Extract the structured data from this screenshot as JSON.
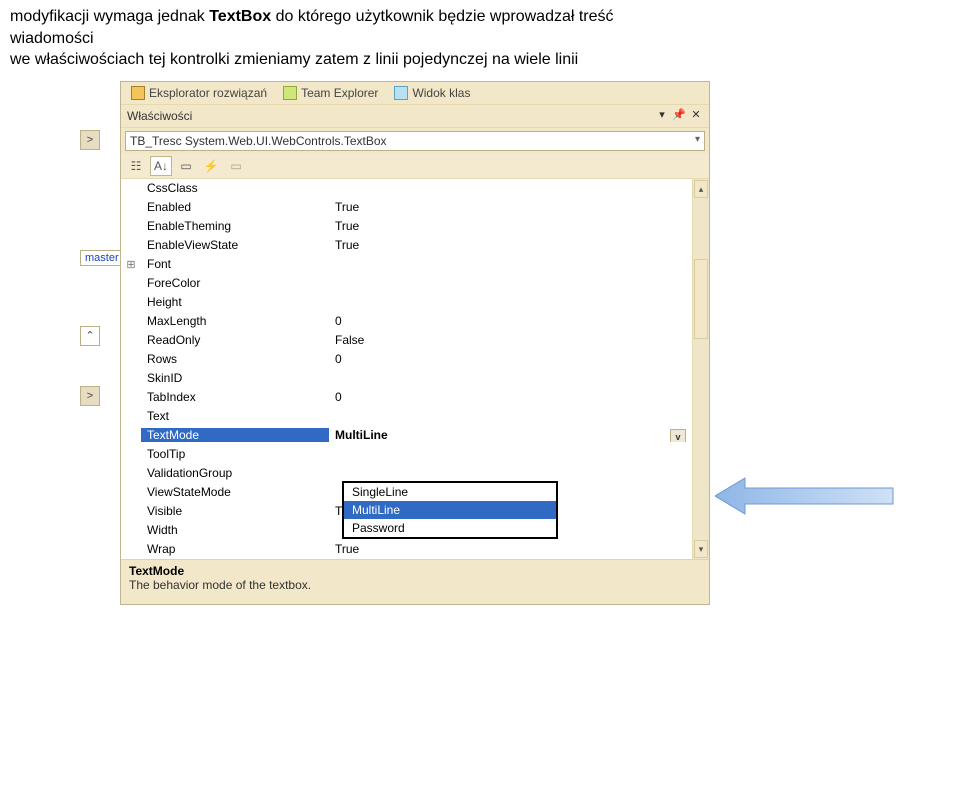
{
  "intro": {
    "line1_a": "modyfikacji wymaga jednak ",
    "line1_bold": "TextBox",
    "line1_b": " do którego użytkownik będzie wprowadzał treść",
    "line2": "wiadomości",
    "line3": "we właściwościach tej kontrolki zmieniamy zatem z linii pojedynczej na wiele linii"
  },
  "tabs": {
    "solutionExplorer": "Eksplorator rozwiązań",
    "teamExplorer": "Team Explorer",
    "classView": "Widok klas"
  },
  "propertiesPane": {
    "title": "Właściwości",
    "objectDisplay": "TB_Tresc System.Web.UI.WebControls.TextBox"
  },
  "grid": [
    {
      "name": "CssClass",
      "value": ""
    },
    {
      "name": "Enabled",
      "value": "True"
    },
    {
      "name": "EnableTheming",
      "value": "True"
    },
    {
      "name": "EnableViewState",
      "value": "True"
    },
    {
      "name": "Font",
      "value": "",
      "expandable": true
    },
    {
      "name": "ForeColor",
      "value": ""
    },
    {
      "name": "Height",
      "value": ""
    },
    {
      "name": "MaxLength",
      "value": "0"
    },
    {
      "name": "ReadOnly",
      "value": "False"
    },
    {
      "name": "Rows",
      "value": "0"
    },
    {
      "name": "SkinID",
      "value": ""
    },
    {
      "name": "TabIndex",
      "value": "0"
    },
    {
      "name": "Text",
      "value": ""
    },
    {
      "name": "TextMode",
      "value": "MultiLine",
      "selected": true
    },
    {
      "name": "ToolTip",
      "value": ""
    },
    {
      "name": "ValidationGroup",
      "value": ""
    },
    {
      "name": "ViewStateMode",
      "value": ""
    },
    {
      "name": "Visible",
      "value": "True"
    },
    {
      "name": "Width",
      "value": ""
    },
    {
      "name": "Wrap",
      "value": "True"
    }
  ],
  "dropdown": {
    "options": [
      "SingleLine",
      "MultiLine",
      "Password"
    ],
    "chosen": "MultiLine"
  },
  "description": {
    "name": "TextMode",
    "text": "The behavior mode of the textbox."
  },
  "leftDock": {
    "master": "master"
  }
}
